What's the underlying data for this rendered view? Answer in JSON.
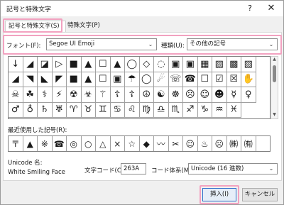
{
  "window": {
    "title": "記号と特殊文字",
    "help_glyph": "?",
    "close_glyph": "✕"
  },
  "tabs": [
    {
      "label": "記号と特殊文字(S)"
    },
    {
      "label": "特殊文字(P)"
    }
  ],
  "font": {
    "label": "フォント(F):",
    "value": "Segoe UI Emoji"
  },
  "subset": {
    "label": "種類(U):",
    "value": "その他の記号"
  },
  "symbols": [
    "↓",
    "◢",
    "◪",
    "▷",
    "■",
    "▲",
    "☐",
    "▲",
    "◯",
    "◇",
    "◌",
    "▣",
    "▣",
    "▦",
    "▨",
    "▩",
    "▧",
    "◢",
    "◥",
    "◣",
    "◤",
    "■",
    "▲",
    "☐",
    "▣",
    "☂",
    "◯",
    "☄",
    "☏",
    "☎",
    "☐",
    "☑",
    "☒",
    "✋",
    "☠",
    "☘",
    "⚕",
    "⚡",
    "☢",
    "☣",
    "⚚",
    "☦",
    "☦",
    "☮",
    "☯",
    "☸",
    "☹",
    "☺",
    "☻",
    "☿",
    "♀",
    "♂",
    "♁",
    "♄",
    "♅",
    "♈",
    "♉",
    "♊",
    "♋",
    "♌",
    "♍",
    "♎",
    "♏",
    "♐",
    "♑",
    "♒",
    "♓"
  ],
  "selected_symbol": "☺",
  "recent_label": "最近使用した記号(R):",
  "recent_symbols": [
    "〒",
    "▲",
    "※",
    "☎",
    "◎",
    "○",
    "△",
    "×",
    "☆",
    "◆",
    "〰",
    "✂",
    "☺",
    "♨",
    "☹",
    "㈱",
    "㈲"
  ],
  "unicode_name": {
    "label": "Unicode 名:",
    "value": "White Smiling Face"
  },
  "char_code": {
    "label": "文字コード(C):",
    "value": "263A"
  },
  "code_system": {
    "label": "コード体系(M):",
    "value": "Unicode (16 進数)"
  },
  "buttons": {
    "insert": "挿入(I)",
    "cancel": "キャンセル"
  },
  "colors": {
    "selection": "#0a63c9",
    "highlight": "#f2a2c0"
  }
}
